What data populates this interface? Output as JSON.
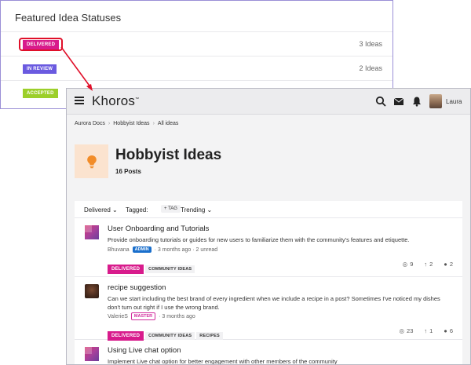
{
  "statuses_panel": {
    "title": "Featured Idea Statuses",
    "rows": [
      {
        "label": "DELIVERED",
        "count": "3 Ideas",
        "color": "#d81b8c"
      },
      {
        "label": "IN REVIEW",
        "count": "2 Ideas",
        "color": "#6a5ae0"
      },
      {
        "label": "ACCEPTED",
        "count": "",
        "color": "#9ccf2a"
      }
    ]
  },
  "topbar": {
    "brand": "Khoros",
    "user_name": "Laura",
    "icons": [
      "menu-icon",
      "search-icon",
      "mail-icon",
      "notification-icon"
    ]
  },
  "breadcrumb": [
    "Aurora Docs",
    "Hobbyist Ideas",
    "All ideas"
  ],
  "board": {
    "title": "Hobbyist Ideas",
    "post_count": "16 Posts",
    "icon": "lightbulb-icon",
    "accent": "#f28c28"
  },
  "filters": {
    "status": "Delivered",
    "tagged_label": "Tagged:",
    "tag_button": "TAG",
    "sort": "Trending"
  },
  "ideas": [
    {
      "title": "User Onboarding and Tutorials",
      "description": "Provide onboarding tutorials or guides for new users to familiarize them with the community's features and etiquette.",
      "author": "Bhuvana",
      "role": "ADMIN",
      "time": "· 3 months ago · 2 unread",
      "status": "DELIVERED",
      "tags": [
        "COMMUNITY IDEAS"
      ],
      "views": "9",
      "kudos": "2",
      "comments": "2"
    },
    {
      "title": "recipe suggestion",
      "description": "Can we start including the best brand of every ingredient when we include a recipe in a post? Sometimes I've noticed my dishes don't turn out right if I use the wrong brand.",
      "author": "ValerieS",
      "role": "MASTER",
      "time": "· 3 months ago",
      "status": "DELIVERED",
      "tags": [
        "COMMUNITY IDEAS",
        "RECIPES"
      ],
      "views": "23",
      "kudos": "1",
      "comments": "6"
    },
    {
      "title": "Using Live chat option",
      "description": "Implement Live chat option for better engagement with other members of the community"
    }
  ]
}
